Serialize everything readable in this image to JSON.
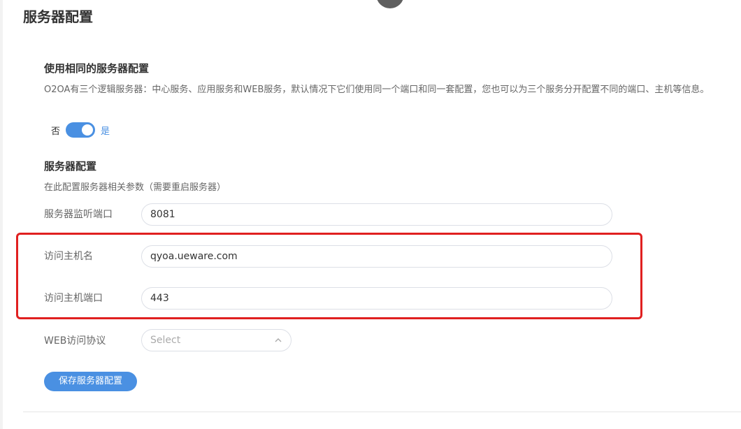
{
  "page": {
    "title": "服务器配置"
  },
  "same_config": {
    "heading": "使用相同的服务器配置",
    "description": "O2OA有三个逻辑服务器：中心服务、应用服务和WEB服务，默认情况下它们使用同一个端口和同一套配置，您也可以为三个服务分开配置不同的端口、主机等信息。",
    "toggle": {
      "off_label": "否",
      "on_label": "是",
      "state": "on"
    }
  },
  "server_config": {
    "heading": "服务器配置",
    "description": "在此配置服务器相关参数（需要重启服务器）",
    "fields": {
      "listen_port": {
        "label": "服务器监听端口",
        "value": "8081"
      },
      "host_name": {
        "label": "访问主机名",
        "value": "qyoa.ueware.com"
      },
      "host_port": {
        "label": "访问主机端口",
        "value": "443"
      },
      "web_protocol": {
        "label": "WEB访问协议",
        "placeholder": "Select"
      }
    },
    "save_label": "保存服务器配置"
  },
  "colors": {
    "accent": "#4a90e2",
    "highlight": "#e02020"
  },
  "icons": {
    "select_arrow": "chevron-up-icon"
  }
}
